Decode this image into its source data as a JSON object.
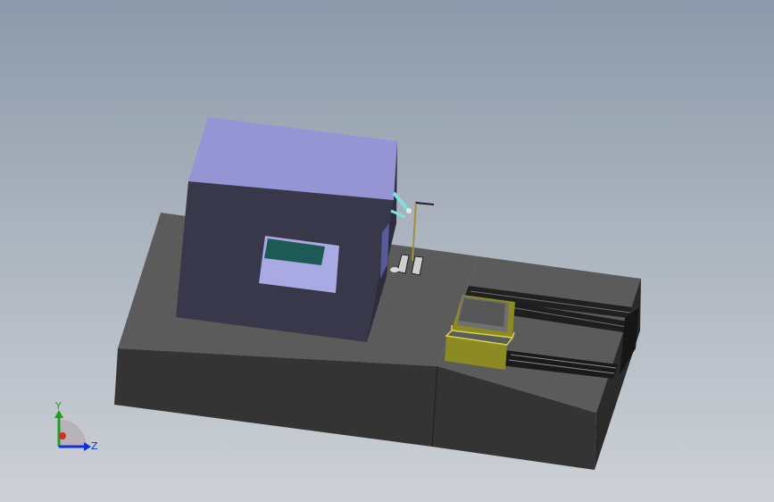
{
  "viewport": {
    "background_top": "#8d9aab",
    "background_bottom": "#cdd1d6"
  },
  "triad": {
    "y_label": "Y",
    "z_label": "Z",
    "y_color": "#1ea01e",
    "z_color": "#1030d8",
    "x_color": "#d03020"
  },
  "colors": {
    "base_top": "#5b5b5b",
    "base_front": "#343434",
    "base_right": "#2a2a2a",
    "enclosure_top": "#9595d6",
    "enclosure_front": "#38384a",
    "enclosure_side": "#2d2d3d",
    "window_glass": "#1e5a55",
    "window_inner": "#a9a9e3",
    "fixture_yellow": "#8c8a22",
    "fixture_outline": "#d8d44a",
    "arm_cyan": "#7fe0e0"
  }
}
